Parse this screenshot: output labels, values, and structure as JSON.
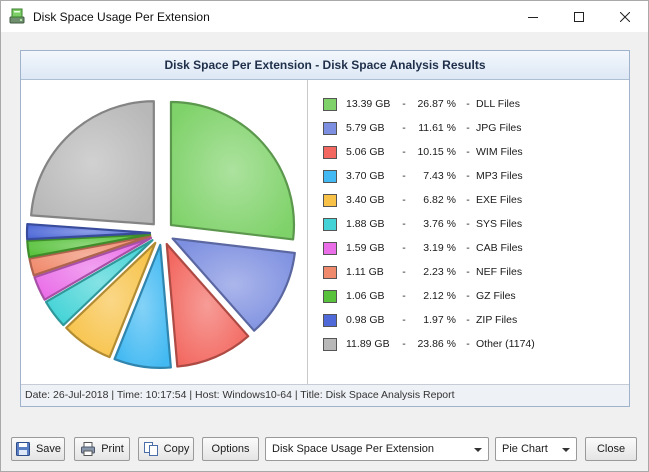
{
  "window": {
    "title": "Disk Space Usage Per Extension"
  },
  "report": {
    "header": "Disk Space Per Extension - Disk Space Analysis Results",
    "footer": "Date: 26-Jul-2018 | Time: 10:17:54 | Host: Windows10-64 | Title: Disk Space Analysis Report"
  },
  "legend": [
    {
      "size": "13.39 GB",
      "pct": "26.87 %",
      "name": "DLL Files",
      "color": "#7fd26a"
    },
    {
      "size": "5.79 GB",
      "pct": "11.61 %",
      "name": "JPG Files",
      "color": "#7d8fe0"
    },
    {
      "size": "5.06 GB",
      "pct": "10.15 %",
      "name": "WIM Files",
      "color": "#f2675f"
    },
    {
      "size": "3.70 GB",
      "pct": "7.43 %",
      "name": "MP3 Files",
      "color": "#42b9f2"
    },
    {
      "size": "3.40 GB",
      "pct": "6.82 %",
      "name": "EXE Files",
      "color": "#f7c247"
    },
    {
      "size": "1.88 GB",
      "pct": "3.76 %",
      "name": "SYS Files",
      "color": "#43d3d6"
    },
    {
      "size": "1.59 GB",
      "pct": "3.19 %",
      "name": "CAB Files",
      "color": "#ea6ee8"
    },
    {
      "size": "1.11 GB",
      "pct": "2.23 %",
      "name": "NEF Files",
      "color": "#f08a6c"
    },
    {
      "size": "1.06 GB",
      "pct": "2.12 %",
      "name": "GZ Files",
      "color": "#58c23c"
    },
    {
      "size": "0.98 GB",
      "pct": "1.97 %",
      "name": "ZIP Files",
      "color": "#4f6ad8"
    },
    {
      "size": "11.89 GB",
      "pct": "23.86 %",
      "name": "Other (1174)",
      "color": "#b8b8b8"
    }
  ],
  "chart_data": {
    "type": "pie",
    "title": "Disk Space Per Extension - Disk Space Analysis Results",
    "categories": [
      "DLL Files",
      "JPG Files",
      "WIM Files",
      "MP3 Files",
      "EXE Files",
      "SYS Files",
      "CAB Files",
      "NEF Files",
      "GZ Files",
      "ZIP Files",
      "Other (1174)"
    ],
    "values": [
      26.87,
      11.61,
      10.15,
      7.43,
      6.82,
      3.76,
      3.19,
      2.23,
      2.12,
      1.97,
      23.86
    ],
    "sizes_gb": [
      13.39,
      5.79,
      5.06,
      3.7,
      3.4,
      1.88,
      1.59,
      1.11,
      1.06,
      0.98,
      11.89
    ],
    "colors": [
      "#7fd26a",
      "#7d8fe0",
      "#f2675f",
      "#42b9f2",
      "#f7c247",
      "#43d3d6",
      "#ea6ee8",
      "#f08a6c",
      "#58c23c",
      "#4f6ad8",
      "#b8b8b8"
    ],
    "legend_position": "right"
  },
  "buttons": {
    "save": "Save",
    "print": "Print",
    "copy": "Copy",
    "options": "Options",
    "close": "Close"
  },
  "report_select": {
    "value": "Disk Space Usage Per Extension"
  },
  "chart_type_select": {
    "value": "Pie Chart"
  }
}
